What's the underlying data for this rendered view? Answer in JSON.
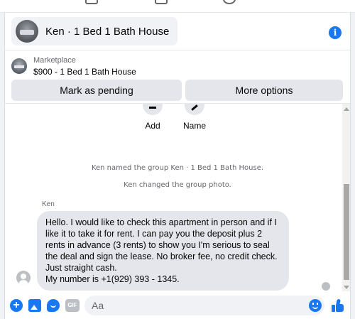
{
  "colors": {
    "accent": "#1877f2",
    "bubble": "#e4e6eb",
    "muted": "#65676b"
  },
  "header": {
    "title": "Ken · 1 Bed 1 Bath House",
    "avatar_icon": "group-photo",
    "info_icon": "info-icon",
    "info_glyph": "i"
  },
  "marketplace": {
    "label": "Marketplace",
    "item": "$900 - 1 Bed 1 Bath House",
    "buttons": {
      "pending": "Mark as pending",
      "more": "More options"
    }
  },
  "actions": [
    {
      "label": "Add",
      "icon": "add-person-icon"
    },
    {
      "label": "Name",
      "icon": "pencil-icon"
    }
  ],
  "system_messages": [
    "Ken named the group Ken · 1 Bed 1 Bath House.",
    "Ken changed the group photo."
  ],
  "message": {
    "sender": "Ken",
    "lines": [
      "Hello. I would like to check this apartment in person and if I like it to take it for rent. I can pay you the deposit plus 2 rents in advance (3 rents) to show you I'm serious to seal the deal and sign the lease. No broker fee, no credit check. Just straight cash.",
      "My number is +1(929) 393 - 1345."
    ]
  },
  "composer": {
    "placeholder": "Aa",
    "plus_glyph": "+",
    "gif_label": "GIF",
    "icons": [
      "plus-icon",
      "photo-icon",
      "sticker-icon",
      "gif-icon",
      "emoji-icon",
      "like-icon"
    ]
  }
}
